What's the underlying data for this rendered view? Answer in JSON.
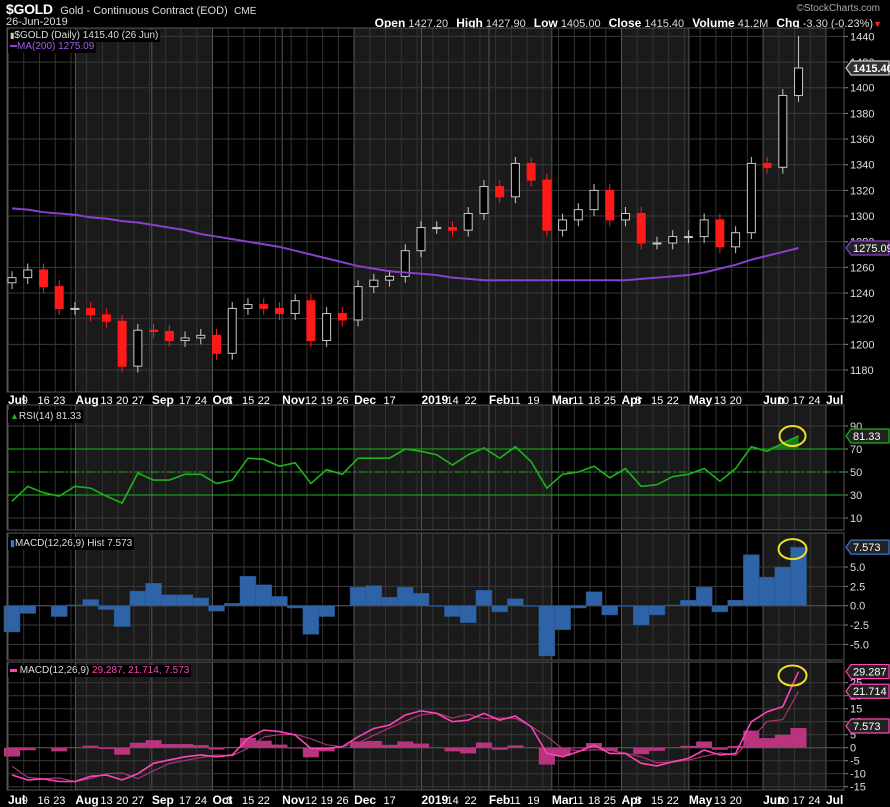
{
  "header": {
    "symbol": "$GOLD",
    "description": "Gold - Continuous Contract (EOD)",
    "exchange": "CME",
    "date": "26-Jun-2019",
    "copyright": "©StockCharts.com",
    "open_label": "Open",
    "open": "1427.20",
    "high_label": "High",
    "high": "1427.90",
    "low_label": "Low",
    "low": "1405.00",
    "close_label": "Close",
    "close": "1415.40",
    "volume_label": "Volume",
    "volume": "41.2M",
    "chg_label": "Chg",
    "chg": "-3.30 (-0.23%)",
    "chg_icon": "down-triangle-icon"
  },
  "legends": {
    "price": "$GOLD (Daily) 1415.40 (26 Jun)",
    "ma": "MA(200) 1275.09",
    "rsi": "RSI(14) 81.33",
    "hist": "MACD(12,26,9) Hist 7.573",
    "macd_name": "MACD(12,26,9)",
    "macd_values": "29.287, 21.714, 7.573"
  },
  "colors": {
    "up": "#c8c8c8",
    "down": "#ff1a1a",
    "ma": "#8a3fd1",
    "rsi": "#1db31d",
    "hist": "#2f63a8",
    "macd": "#ff44b8",
    "signal": "#a83574",
    "macd_hist": "#b8357e",
    "highlight": "#f0e020"
  },
  "chart_data": [
    {
      "type": "candlestick",
      "title": "$GOLD (Daily)",
      "x_start": "2018-07-02",
      "x_step_days": 7,
      "x_end": "2019-07-01",
      "close": [
        1252,
        1258,
        1245,
        1228,
        1228,
        1223,
        1218,
        1183,
        1211,
        1210,
        1203,
        1205,
        1207,
        1193,
        1228,
        1231,
        1228,
        1224,
        1234,
        1203,
        1224,
        1219,
        1245,
        1250,
        1253,
        1273,
        1291,
        1291,
        1289,
        1302,
        1323,
        1315,
        1341,
        1328,
        1289,
        1297,
        1305,
        1320,
        1297,
        1302,
        1279,
        1279,
        1284,
        1284,
        1297,
        1276,
        1287,
        1341,
        1338,
        1394,
        1415.4
      ],
      "ma200": [
        1306,
        1305,
        1303,
        1302,
        1301,
        1299,
        1298,
        1296,
        1295,
        1293,
        1291,
        1289,
        1286,
        1284,
        1282,
        1280,
        1278,
        1276,
        1273,
        1270,
        1267,
        1264,
        1261,
        1259,
        1257,
        1256,
        1255,
        1254,
        1252,
        1251,
        1250,
        1250,
        1250,
        1250,
        1250,
        1250,
        1250,
        1250,
        1250,
        1250,
        1251,
        1252,
        1253,
        1254,
        1256,
        1259,
        1262,
        1266,
        1269,
        1272,
        1275.09
      ],
      "ylim": [
        1160,
        1450
      ],
      "ticks": [
        "1180",
        "1200",
        "1220",
        "1240",
        "1260",
        "1280",
        "1300",
        "1320",
        "1340",
        "1360",
        "1380",
        "1400",
        "1420",
        "1440"
      ],
      "last_tag": "1415.40",
      "ma_tag": "1275.09"
    },
    {
      "type": "line",
      "title": "RSI(14)",
      "values": [
        24.5,
        37.5,
        32,
        29,
        37.5,
        36,
        29,
        23,
        49,
        43,
        43,
        48,
        48,
        40,
        43,
        62,
        61,
        55,
        58,
        40,
        52,
        48,
        62,
        62,
        62,
        70,
        68,
        65,
        56,
        65,
        71,
        62,
        72,
        59,
        36,
        48,
        50,
        55,
        45,
        53,
        37.5,
        39,
        46,
        48,
        53,
        42,
        53,
        72,
        68,
        75,
        81.33
      ],
      "ylim": [
        0,
        100
      ],
      "levels": [
        30,
        50,
        70
      ],
      "ticks": [
        "10",
        "30",
        "50",
        "70",
        "90"
      ],
      "last_tag": "81.33"
    },
    {
      "type": "bar",
      "title": "MACD(12,26,9) Hist",
      "values": [
        -3.4,
        -1.0,
        0,
        -1.4,
        0.1,
        0.8,
        -0.5,
        -2.7,
        1.9,
        2.9,
        1.4,
        1.4,
        1.0,
        -0.7,
        0.3,
        3.8,
        2.7,
        1.2,
        -0.3,
        -3.7,
        -1.4,
        0,
        2.4,
        2.6,
        1.1,
        2.4,
        1.6,
        -0.1,
        -1.4,
        -2.2,
        2.0,
        -0.8,
        0.9,
        -0.1,
        -6.5,
        -3.1,
        -0.3,
        1.8,
        -1.2,
        -0.1,
        -2.5,
        -1.2,
        0.1,
        0.7,
        2.4,
        -0.8,
        0.7,
        6.6,
        3.7,
        5.0,
        7.573
      ],
      "ylim": [
        -7.5,
        9.5
      ],
      "ticks": [
        "-5.0",
        "-2.5",
        "0.0",
        "2.5",
        "5.0"
      ],
      "last_tag": "7.573"
    },
    {
      "type": "line",
      "title": "MACD(12,26,9)",
      "macd": [
        -10.5,
        -12.4,
        -12,
        -13,
        -13,
        -11,
        -10.5,
        -12.4,
        -10,
        -6,
        -4.7,
        -3.5,
        -2.8,
        -3.5,
        -2.8,
        3.6,
        6.8,
        6.2,
        4.9,
        -0.3,
        -0.3,
        0.4,
        4.2,
        7.4,
        8.7,
        12.6,
        14.2,
        13.2,
        10,
        10.6,
        13.2,
        10.6,
        12.2,
        8.1,
        -2.2,
        -3.5,
        -1.5,
        1,
        -2.2,
        -2.2,
        -6,
        -7,
        -5.4,
        -4.1,
        -0.9,
        -2.8,
        -2.2,
        10,
        13.8,
        15.8,
        29.287
      ],
      "signal_equals": "macd - hist",
      "ylim": [
        -17,
        33
      ],
      "ticks": [
        "-15",
        "-10",
        "-5",
        "0",
        "5",
        "10",
        "15",
        "20",
        "25"
      ],
      "tags": [
        "29.287",
        "21.714",
        "7.573"
      ]
    }
  ],
  "x_axis": [
    {
      "t": "Jul",
      "d": "2018-07-02",
      "m": true
    },
    {
      "t": "9",
      "d": "2018-07-09"
    },
    {
      "t": "16",
      "d": "2018-07-16"
    },
    {
      "t": "23",
      "d": "2018-07-23"
    },
    {
      "t": "Aug",
      "d": "2018-08-01",
      "m": true
    },
    {
      "t": "13",
      "d": "2018-08-13"
    },
    {
      "t": "20",
      "d": "2018-08-20"
    },
    {
      "t": "27",
      "d": "2018-08-27"
    },
    {
      "t": "Sep",
      "d": "2018-09-04",
      "m": true
    },
    {
      "t": "17",
      "d": "2018-09-17"
    },
    {
      "t": "24",
      "d": "2018-09-24"
    },
    {
      "t": "Oct",
      "d": "2018-10-01",
      "m": true
    },
    {
      "t": "8",
      "d": "2018-10-08"
    },
    {
      "t": "15",
      "d": "2018-10-15"
    },
    {
      "t": "22",
      "d": "2018-10-22"
    },
    {
      "t": "Nov",
      "d": "2018-11-01",
      "m": true
    },
    {
      "t": "12",
      "d": "2018-11-12"
    },
    {
      "t": "19",
      "d": "2018-11-19"
    },
    {
      "t": "26",
      "d": "2018-11-26"
    },
    {
      "t": "Dec",
      "d": "2018-12-03",
      "m": true
    },
    {
      "t": "17",
      "d": "2018-12-17"
    },
    {
      "t": "2019",
      "d": "2019-01-02",
      "m": true
    },
    {
      "t": "14",
      "d": "2019-01-14"
    },
    {
      "t": "22",
      "d": "2019-01-22"
    },
    {
      "t": "Feb",
      "d": "2019-02-01",
      "m": true
    },
    {
      "t": "11",
      "d": "2019-02-11"
    },
    {
      "t": "19",
      "d": "2019-02-19"
    },
    {
      "t": "Mar",
      "d": "2019-03-01",
      "m": true
    },
    {
      "t": "11",
      "d": "2019-03-11"
    },
    {
      "t": "18",
      "d": "2019-03-18"
    },
    {
      "t": "25",
      "d": "2019-03-25"
    },
    {
      "t": "Apr",
      "d": "2019-04-01",
      "m": true
    },
    {
      "t": "8",
      "d": "2019-04-08"
    },
    {
      "t": "15",
      "d": "2019-04-15"
    },
    {
      "t": "22",
      "d": "2019-04-22"
    },
    {
      "t": "May",
      "d": "2019-05-01",
      "m": true
    },
    {
      "t": "13",
      "d": "2019-05-13"
    },
    {
      "t": "20",
      "d": "2019-05-20"
    },
    {
      "t": "Jun",
      "d": "2019-06-03",
      "m": true
    },
    {
      "t": "10",
      "d": "2019-06-10"
    },
    {
      "t": "17",
      "d": "2019-06-17"
    },
    {
      "t": "24",
      "d": "2019-06-24"
    },
    {
      "t": "Jul",
      "d": "2019-07-01",
      "m": true
    }
  ]
}
